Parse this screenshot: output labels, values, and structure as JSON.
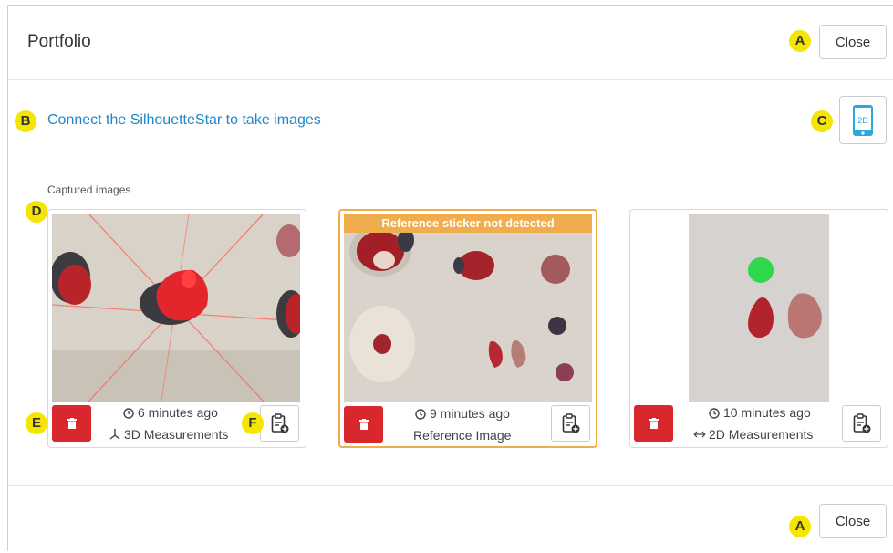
{
  "header": {
    "title": "Portfolio",
    "close_label": "Close"
  },
  "footer": {
    "close_label": "Close"
  },
  "connect_link": "Connect the SilhouetteStar to take images",
  "mode_button": {
    "label": "2D",
    "icon": "tablet-icon"
  },
  "section_label": "Captured images",
  "markers": {
    "a": "A",
    "b": "B",
    "c": "C",
    "d": "D",
    "e": "E",
    "f": "F"
  },
  "cards": [
    {
      "time": "6 minutes ago",
      "type": "3D Measurements",
      "type_icon": "3d-axes-icon",
      "warning": ""
    },
    {
      "time": "9 minutes ago",
      "type": "Reference Image",
      "type_icon": "",
      "warning": "Reference sticker not detected"
    },
    {
      "time": "10 minutes ago",
      "type": "2D Measurements",
      "type_icon": "horizontal-arrows-icon",
      "warning": ""
    }
  ],
  "colors": {
    "link": "#1e88c7",
    "delete": "#d9272e",
    "warning": "#f0ad4e",
    "marker": "#f5e600"
  }
}
